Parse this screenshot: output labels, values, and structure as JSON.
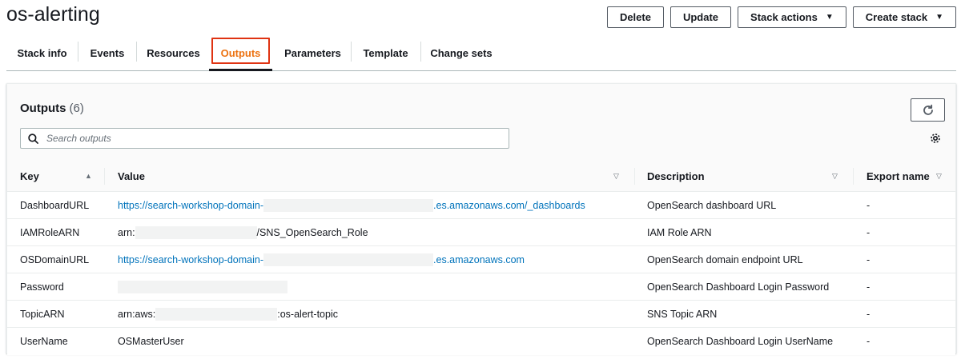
{
  "page": {
    "title": "os-alerting"
  },
  "actions": {
    "delete": "Delete",
    "update": "Update",
    "stack_actions": "Stack actions",
    "create_stack": "Create stack"
  },
  "tabs": [
    {
      "label": "Stack info",
      "active": false
    },
    {
      "label": "Events",
      "active": false
    },
    {
      "label": "Resources",
      "active": false
    },
    {
      "label": "Outputs",
      "active": true
    },
    {
      "label": "Parameters",
      "active": false
    },
    {
      "label": "Template",
      "active": false
    },
    {
      "label": "Change sets",
      "active": false
    }
  ],
  "outputs": {
    "title": "Outputs",
    "count": "(6)",
    "search_placeholder": "Search outputs",
    "columns": {
      "key": "Key",
      "value": "Value",
      "description": "Description",
      "export": "Export name"
    },
    "rows": [
      {
        "key": "DashboardURL",
        "value_prefix": "https://search-workshop-domain-",
        "value_suffix": ".es.amazonaws.com/_dashboards",
        "description": "OpenSearch dashboard URL",
        "export": "-"
      },
      {
        "key": "IAMRoleARN",
        "value_prefix": "arn:",
        "value_suffix": "/SNS_OpenSearch_Role",
        "description": "IAM Role ARN",
        "export": "-"
      },
      {
        "key": "OSDomainURL",
        "value_prefix": "https://search-workshop-domain-",
        "value_suffix": ".es.amazonaws.com",
        "description": "OpenSearch domain endpoint URL",
        "export": "-"
      },
      {
        "key": "Password",
        "value_prefix": "",
        "value_suffix": "",
        "description": "OpenSearch Dashboard Login Password",
        "export": "-"
      },
      {
        "key": "TopicARN",
        "value_prefix": "arn:aws:",
        "value_suffix": ":os-alert-topic",
        "description": "SNS Topic ARN",
        "export": "-"
      },
      {
        "key": "UserName",
        "value_prefix": "OSMasterUser",
        "value_suffix": "",
        "description": "OpenSearch Dashboard Login UserName",
        "export": "-"
      }
    ]
  },
  "colors": {
    "link": "#0073bb",
    "active_tab": "#ec7211",
    "highlight_box": "#df3312"
  },
  "icons": {
    "search": "search-icon",
    "refresh": "refresh-icon",
    "settings": "gear-icon",
    "sort": "caret-up-icon",
    "dropdown": "caret-down-icon"
  }
}
